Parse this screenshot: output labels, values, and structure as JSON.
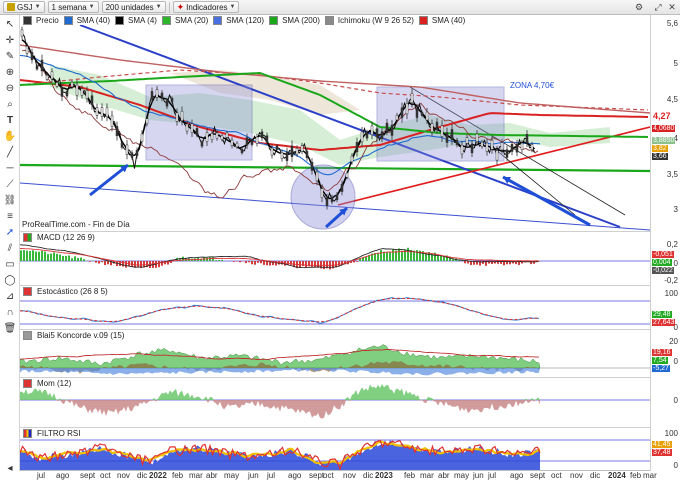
{
  "toolbar": {
    "symbol": "GSJ",
    "timeframe": "1 semana",
    "units": "200 unidades",
    "indicators": "Indicadores"
  },
  "price_panel": {
    "legend": [
      {
        "label": "Precio",
        "color": "#333333"
      },
      {
        "label": "SMA (40)",
        "color": "#1f6bd1"
      },
      {
        "label": "SMA (4)",
        "color": "#000000"
      },
      {
        "label": "SMA (20)",
        "color": "#2bb52b"
      },
      {
        "label": "SMA (120)",
        "color": "#4a6fe0"
      },
      {
        "label": "SMA (200)",
        "color": "#1aa81a"
      },
      {
        "label": "Ichimoku (W 9 26 52)",
        "color": "#8a8a8a"
      },
      {
        "label": "SMA (40)",
        "color": "#d92121"
      }
    ],
    "annotation": "ZONA 4,70€",
    "source": "ProRealTime.com - Fin de Día",
    "scale": [
      "5,6",
      "5",
      "4,5",
      "4",
      "3,5",
      "3"
    ],
    "last_price_tag": "4,27",
    "small_tags": [
      "4,0680",
      "3,8850",
      "3,82",
      "3,66"
    ]
  },
  "macd": {
    "label": "MACD (12 26 9)",
    "scale": [
      "0,2",
      "0",
      "-0,2"
    ],
    "tags": [
      "-0,051",
      "0,004",
      "-0,022"
    ]
  },
  "stoch": {
    "label": "Estocástico (26 8 5)",
    "scale": [
      "100",
      "0"
    ],
    "tags": [
      "29,48",
      "27,643"
    ]
  },
  "koncorde": {
    "label": "Blai5 Koncorde v.09 (15)",
    "scale": [
      "20",
      "0"
    ],
    "tags": [
      "19,16",
      "7,54",
      "-5,27"
    ]
  },
  "mom": {
    "label": "Mom (12)",
    "scale": [
      "0"
    ],
    "tags": []
  },
  "rsi": {
    "label": "FILTRO RSI",
    "scale": [
      "100",
      "0"
    ],
    "tags": [
      "41,45",
      "37,48"
    ]
  },
  "xaxis": {
    "labels": [
      "jul",
      "ago",
      "sept",
      "oct",
      "nov",
      "dic",
      "2022",
      "feb",
      "mar",
      "abr",
      "may",
      "jun",
      "jul",
      "ago",
      "sept",
      "oct",
      "nov",
      "dic",
      "2023",
      "feb",
      "mar",
      "abr",
      "may",
      "jun",
      "jul",
      "ago",
      "sept",
      "oct",
      "nov",
      "dic",
      "2024",
      "feb",
      "mar"
    ]
  },
  "colors": {
    "accent": "#1f4fd6",
    "sma_red": "#d92121",
    "sma_green": "#1aa81a",
    "cloud": "#c7e8c7"
  }
}
